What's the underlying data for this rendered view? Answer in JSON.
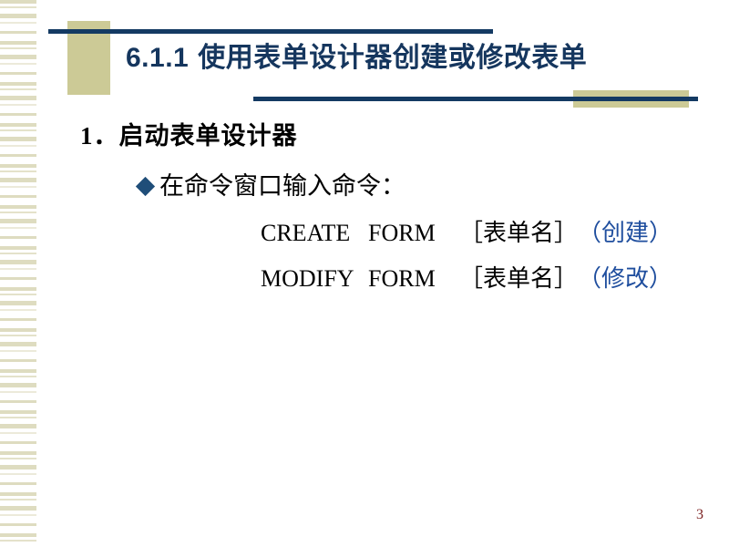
{
  "slide": {
    "title": {
      "number": "6.1.1",
      "text": "使用表单设计器创建或修改表单"
    },
    "content": {
      "item1": "1．启动表单设计器",
      "item2": "在命令窗口输入命令：",
      "bullet_icon": "diamond-bullet-icon",
      "commands": [
        {
          "keyword": "CREATE",
          "object": "FORM",
          "argument": "［表单名］",
          "note": "（创建）"
        },
        {
          "keyword": "MODIFY",
          "object": "FORM",
          "argument": "［表单名］",
          "note": "（修改）"
        }
      ]
    },
    "page_number": "3",
    "colors": {
      "accent_navy": "#143a63",
      "accent_khaki": "#ccca96",
      "title_navy": "#15365e",
      "note_blue": "#1f4e9e",
      "page_number_red": "#7b2020"
    }
  }
}
